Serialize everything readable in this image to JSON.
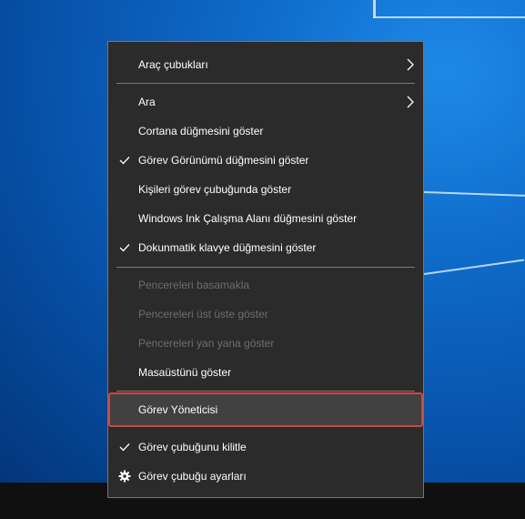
{
  "context_menu": {
    "items": [
      {
        "label": "Araç çubukları",
        "has_submenu": true,
        "checked": false,
        "enabled": true
      },
      {
        "label": "Ara",
        "has_submenu": true,
        "checked": false,
        "enabled": true
      },
      {
        "label": "Cortana düğmesini göster",
        "has_submenu": false,
        "checked": false,
        "enabled": true
      },
      {
        "label": "Görev Görünümü düğmesini göster",
        "has_submenu": false,
        "checked": true,
        "enabled": true
      },
      {
        "label": "Kişileri görev çubuğunda göster",
        "has_submenu": false,
        "checked": false,
        "enabled": true
      },
      {
        "label": "Windows Ink Çalışma Alanı düğmesini göster",
        "has_submenu": false,
        "checked": false,
        "enabled": true
      },
      {
        "label": "Dokunmatik klavye düğmesini göster",
        "has_submenu": false,
        "checked": true,
        "enabled": true
      },
      {
        "label": "Pencereleri basamakla",
        "has_submenu": false,
        "checked": false,
        "enabled": false
      },
      {
        "label": "Pencereleri üst üste göster",
        "has_submenu": false,
        "checked": false,
        "enabled": false
      },
      {
        "label": "Pencereleri yan yana göster",
        "has_submenu": false,
        "checked": false,
        "enabled": false
      },
      {
        "label": "Masaüstünü göster",
        "has_submenu": false,
        "checked": false,
        "enabled": true
      },
      {
        "label": "Görev Yöneticisi",
        "has_submenu": false,
        "checked": false,
        "enabled": true,
        "highlighted": true
      },
      {
        "label": "Görev çubuğunu kilitle",
        "has_submenu": false,
        "checked": true,
        "enabled": true
      },
      {
        "label": "Görev çubuğu ayarları",
        "has_submenu": false,
        "checked": false,
        "enabled": true,
        "icon": "gear-icon"
      }
    ]
  },
  "colors": {
    "menu_background": "#2b2b2b",
    "menu_border": "#767676",
    "highlight_background": "#414141",
    "highlight_border": "#d24545",
    "enabled_text": "#ffffff",
    "disabled_text": "#6d6d6d",
    "taskbar": "#101010"
  }
}
